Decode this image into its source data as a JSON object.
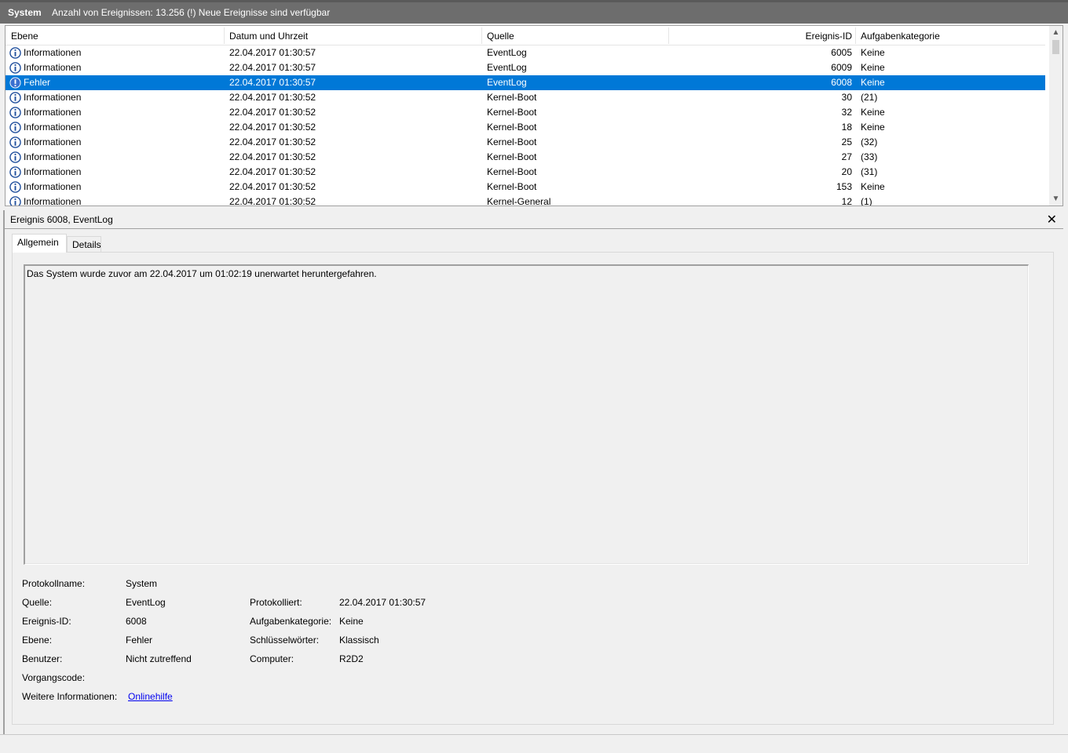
{
  "titlebar": {
    "log_name": "System",
    "status": "Anzahl von Ereignissen: 13.256 (!) Neue Ereignisse sind verfügbar"
  },
  "columns": {
    "level": "Ebene",
    "date": "Datum und Uhrzeit",
    "source": "Quelle",
    "event_id": "Ereignis-ID",
    "category": "Aufgabenkategorie"
  },
  "events": [
    {
      "level": "Informationen",
      "date": "22.04.2017 01:30:57",
      "source": "EventLog",
      "id": "6005",
      "category": "Keine",
      "icon": "info-icon"
    },
    {
      "level": "Informationen",
      "date": "22.04.2017 01:30:57",
      "source": "EventLog",
      "id": "6009",
      "category": "Keine",
      "icon": "info-icon"
    },
    {
      "level": "Fehler",
      "date": "22.04.2017 01:30:57",
      "source": "EventLog",
      "id": "6008",
      "category": "Keine",
      "icon": "error-icon",
      "selected": true
    },
    {
      "level": "Informationen",
      "date": "22.04.2017 01:30:52",
      "source": "Kernel-Boot",
      "id": "30",
      "category": "(21)",
      "icon": "info-icon"
    },
    {
      "level": "Informationen",
      "date": "22.04.2017 01:30:52",
      "source": "Kernel-Boot",
      "id": "32",
      "category": "Keine",
      "icon": "info-icon"
    },
    {
      "level": "Informationen",
      "date": "22.04.2017 01:30:52",
      "source": "Kernel-Boot",
      "id": "18",
      "category": "Keine",
      "icon": "info-icon"
    },
    {
      "level": "Informationen",
      "date": "22.04.2017 01:30:52",
      "source": "Kernel-Boot",
      "id": "25",
      "category": "(32)",
      "icon": "info-icon"
    },
    {
      "level": "Informationen",
      "date": "22.04.2017 01:30:52",
      "source": "Kernel-Boot",
      "id": "27",
      "category": "(33)",
      "icon": "info-icon"
    },
    {
      "level": "Informationen",
      "date": "22.04.2017 01:30:52",
      "source": "Kernel-Boot",
      "id": "20",
      "category": "(31)",
      "icon": "info-icon"
    },
    {
      "level": "Informationen",
      "date": "22.04.2017 01:30:52",
      "source": "Kernel-Boot",
      "id": "153",
      "category": "Keine",
      "icon": "info-icon"
    },
    {
      "level": "Informationen",
      "date": "22.04.2017 01:30:52",
      "source": "Kernel-General",
      "id": "12",
      "category": "(1)",
      "icon": "info-icon"
    }
  ],
  "detail": {
    "header": "Ereignis 6008, EventLog",
    "close_label": "✕",
    "tabs": [
      "Allgemein",
      "Details"
    ],
    "message": "Das System wurde zuvor am 22.04.2017 um 01:02:19 unerwartet heruntergefahren.",
    "labels": {
      "log_name": "Protokollname:",
      "source": "Quelle:",
      "event_id": "Ereignis-ID:",
      "level": "Ebene:",
      "user": "Benutzer:",
      "opcode": "Vorgangscode:",
      "more_info": "Weitere Informationen:",
      "logged": "Protokolliert:",
      "task_category": "Aufgabenkategorie:",
      "keywords": "Schlüsselwörter:",
      "computer": "Computer:"
    },
    "values": {
      "log_name": "System",
      "source": "EventLog",
      "event_id": "6008",
      "level": "Fehler",
      "user": "Nicht zutreffend",
      "opcode": "",
      "more_info_link": "Onlinehilfe",
      "logged": "22.04.2017 01:30:57",
      "task_category": "Keine",
      "keywords": "Klassisch",
      "computer": "R2D2"
    }
  },
  "colors": {
    "selection": "#0078d7",
    "titlebar": "#6d6d6d",
    "info_icon": "#1f4e9c",
    "error_icon": "#3a6fd0"
  }
}
